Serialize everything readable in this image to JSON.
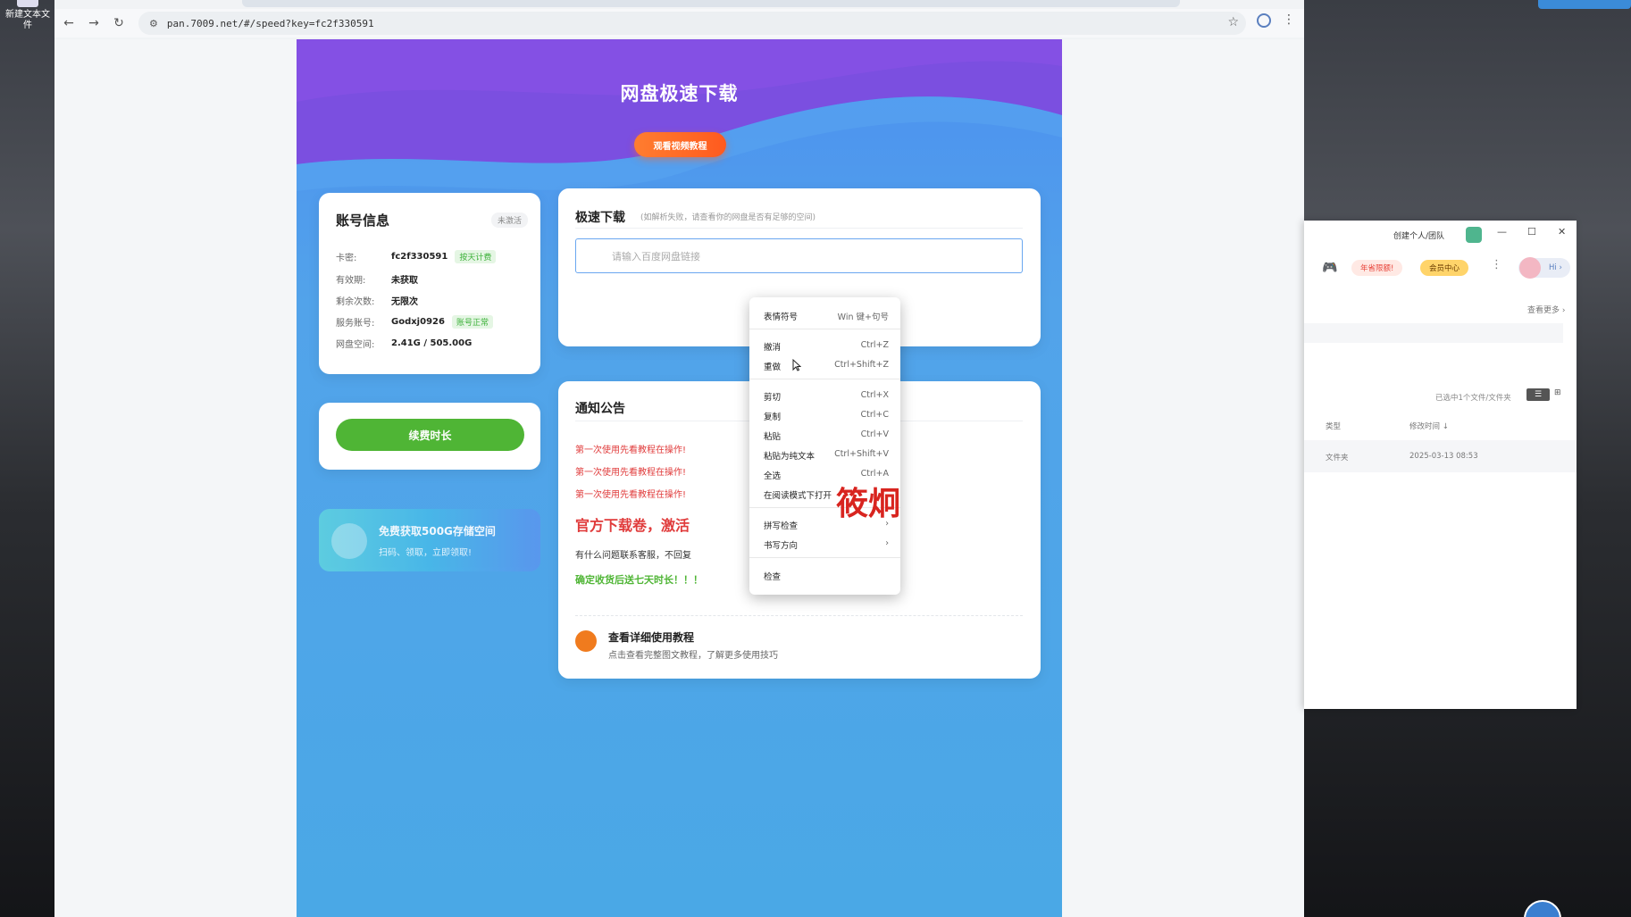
{
  "desktop": {
    "icon_label": "新建文本文\n件"
  },
  "browser": {
    "url": "pan.7009.net/#/speed?key=fc2f330591",
    "nav": {
      "back": "←",
      "forward": "→",
      "reload": "↻"
    }
  },
  "page": {
    "title": "网盘极速下载",
    "tutorial_button": "观看视频教程",
    "account": {
      "title": "账号信息",
      "status": "未激活",
      "rows": [
        {
          "label": "卡密:",
          "value": "fc2f330591",
          "badge": "按天计费"
        },
        {
          "label": "有效期:",
          "value": "未获取",
          "badge": ""
        },
        {
          "label": "剩余次数:",
          "value": "无限次",
          "badge": ""
        },
        {
          "label": "服务账号:",
          "value": "Godxj0926",
          "badge": "账号正常"
        },
        {
          "label": "网盘空间:",
          "value": "2.41G / 505.00G",
          "badge": ""
        }
      ]
    },
    "renew_button": "续费时长",
    "promo": {
      "title": "免费获取500G存储空间",
      "subtitle": "扫码、领取，立即领取!"
    },
    "speed": {
      "title": "极速下载",
      "hint": "(如解析失败，请查看你的网盘是否有足够的空间)",
      "input_placeholder": "请输入百度网盘链接"
    },
    "notice": {
      "title": "通知公告",
      "lines": [
        "第一次使用先看教程在操作!",
        "第一次使用先看教程在操作!",
        "第一次使用先看教程在操作!"
      ],
      "big_text": "官方下载卷，激活",
      "contact_text": "有什么问题联系客服，不回复",
      "gift_text": "确定收货后送七天时长！！！",
      "guide_title": "查看详细使用教程",
      "guide_subtitle": "点击查看完整图文教程，了解更多使用技巧"
    }
  },
  "context_menu": {
    "items": [
      {
        "label": "表情符号",
        "shortcut": "Win 键+句号"
      },
      {
        "label": "撤消",
        "shortcut": "Ctrl+Z"
      },
      {
        "label": "重做",
        "shortcut": "Ctrl+Shift+Z"
      },
      {
        "label": "剪切",
        "shortcut": "Ctrl+X"
      },
      {
        "label": "复制",
        "shortcut": "Ctrl+C"
      },
      {
        "label": "粘贴",
        "shortcut": "Ctrl+V"
      },
      {
        "label": "粘贴为纯文本",
        "shortcut": "Ctrl+Shift+V"
      },
      {
        "label": "全选",
        "shortcut": "Ctrl+A"
      },
      {
        "label": "在阅读模式下打开",
        "shortcut": ""
      },
      {
        "label": "拼写检查",
        "shortcut": "›"
      },
      {
        "label": "书写方向",
        "shortcut": "›"
      },
      {
        "label": "检查",
        "shortcut": ""
      }
    ]
  },
  "annotation": {
    "text": "筱炯"
  },
  "side_app": {
    "title": "创建个人/团队",
    "window_controls": {
      "minimize": "—",
      "maximize": "☐",
      "close": "✕"
    },
    "badge_red": "年省限额!",
    "badge_vip": "会员中心",
    "hi": "Hi ›",
    "more": "查看更多 ›",
    "count_text": "已选中1个文件/文件夹",
    "view_list": "☰",
    "view_grid": "⊞",
    "col_type": "类型",
    "col_time": "修改时间 ↓",
    "row_type": "文件夹",
    "row_time": "2025-03-13 08:53"
  },
  "colors": {
    "page_blue": "#4c8ff0",
    "tutorial_orange": "#ff6a25",
    "renew_green": "#4fb535",
    "notice_red": "#e03b3b",
    "parse_purple": "#8b68ee"
  }
}
